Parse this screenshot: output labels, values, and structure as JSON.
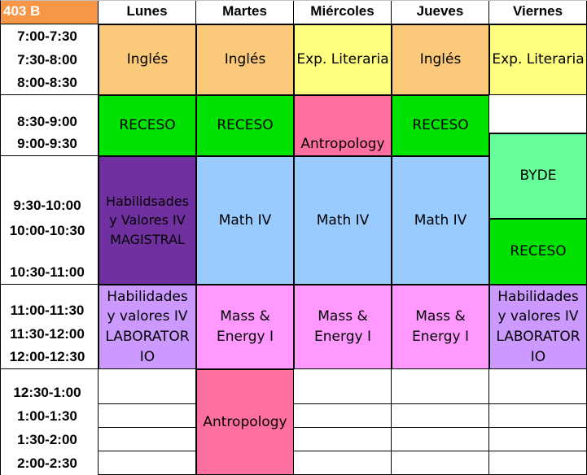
{
  "corner": {
    "text": "403 B",
    "color": "#F79646",
    "text_color": "#FFFFFF"
  },
  "days": [
    "Lunes",
    "Martes",
    "Miércoles",
    "Jueves",
    "Viernes"
  ],
  "times": [
    "7:00-7:30",
    "7:30-8:00",
    "8:00-8:30",
    "8:30-9:00",
    "9:00-9:30",
    "9:30-10:00",
    "10:00-10:30",
    "10:30-11:00",
    "11:00-11:30",
    "11:30-12:00",
    "12:00-12:30",
    "12:30-1:00",
    "1:00-1:30",
    "1:30-2:00",
    "2:00-2:30"
  ],
  "blocks": [
    {
      "id": "lunes-ingles",
      "label": "Inglés",
      "color": "#FAC97A"
    },
    {
      "id": "martes-ingles",
      "label": "Inglés",
      "color": "#FAC97A"
    },
    {
      "id": "miercoles-exp-literaria",
      "label": "Exp. Literaria",
      "color": "#FFFF80"
    },
    {
      "id": "jueves-ingles",
      "label": "Inglés",
      "color": "#FAC97A"
    },
    {
      "id": "viernes-exp-literaria",
      "label": "Exp. Literaria",
      "color": "#FFFF80"
    },
    {
      "id": "lunes-receso",
      "label": "RECESO",
      "color": "#00E300"
    },
    {
      "id": "martes-receso",
      "label": "RECESO",
      "color": "#00E300"
    },
    {
      "id": "miercoles-antropology",
      "label": "Antropology",
      "color": "#FF6FA0"
    },
    {
      "id": "jueves-receso",
      "label": "RECESO",
      "color": "#00E300"
    },
    {
      "id": "viernes-byde",
      "label": "BYDE",
      "color": "#66FF99"
    },
    {
      "id": "lunes-habilidades-magistral",
      "label": "Habilidsades\ny Valores IV\nMAGISTRAL",
      "color": "#7030A0"
    },
    {
      "id": "martes-math",
      "label": "Math IV",
      "color": "#9ACBFF"
    },
    {
      "id": "miercoles-math",
      "label": "Math IV",
      "color": "#9ACBFF"
    },
    {
      "id": "jueves-math",
      "label": "Math IV",
      "color": "#9ACBFF"
    },
    {
      "id": "viernes-receso",
      "label": "RECESO",
      "color": "#00E300"
    },
    {
      "id": "lunes-habilidades-laboratorio",
      "label": "Habilidades\ny valores IV\nLABORATOR\nIO",
      "color": "#CC99FF"
    },
    {
      "id": "martes-mass-energy",
      "label": "Mass &\nEnergy I",
      "color": "#FF99FF"
    },
    {
      "id": "miercoles-mass-energy",
      "label": "Mass &\nEnergy I",
      "color": "#FF99FF"
    },
    {
      "id": "jueves-mass-energy",
      "label": "Mass &\nEnergy I",
      "color": "#FF99FF"
    },
    {
      "id": "viernes-habilidades-laboratorio",
      "label": "Habilidades\ny valores IV\nLABORATOR\nIO",
      "color": "#CC99FF"
    },
    {
      "id": "martes-antropology",
      "label": "Antropology",
      "color": "#FF6FA0"
    }
  ]
}
